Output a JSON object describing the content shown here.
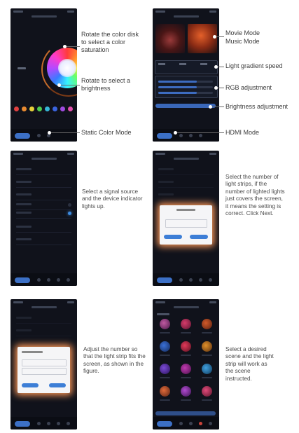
{
  "panels": {
    "p1": {
      "callouts": [
        "Rotate the color disk to select a color saturation",
        "Rotate to select a brightness",
        "Static Color Mode"
      ],
      "swatch_colors": [
        "#e04040",
        "#e88a30",
        "#e6d13a",
        "#4ecb4e",
        "#37b7d8",
        "#3a64e0",
        "#a04be0",
        "#e04fae"
      ]
    },
    "p2": {
      "callouts": [
        "Movie Mode",
        "Music Mode",
        "Light gradient speed",
        "RGB adjustment",
        "Brightness adjustment",
        "HDMI Mode"
      ]
    },
    "p3": {
      "text": "Select a signal source and the device indicator lights up."
    },
    "p4": {
      "text": "Select the number of light strips, if the number of lighted lights just covers the screen, it means the setting is correct. Click Next."
    },
    "p5": {
      "text": "Adjust the number so that the light strip fits the screen, as shown in the figure."
    },
    "p6": {
      "text": "Select a desired scene and the light strip will work as the scene instructed."
    }
  },
  "colors": {
    "phone_bg": "#10121b",
    "accent_blue": "#3c70c6",
    "modal_glow": "#ff9a5a"
  }
}
